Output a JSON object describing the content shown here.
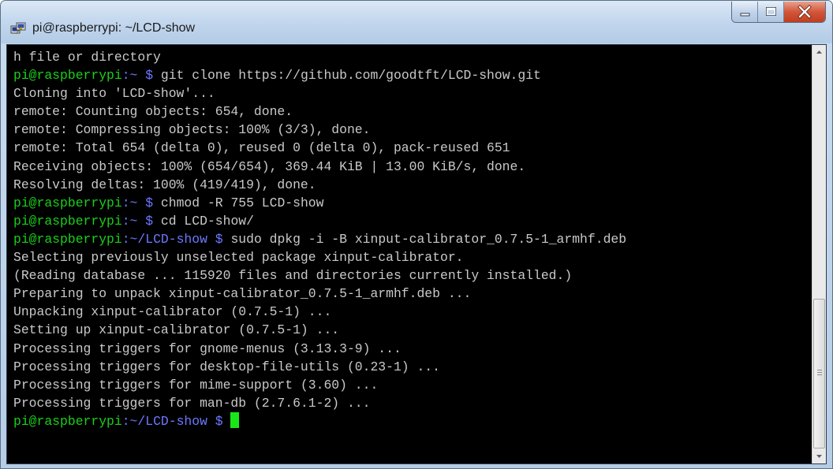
{
  "window": {
    "title": "pi@raspberrypi: ~/LCD-show",
    "icon": "putty-icon",
    "controls": [
      "minimize-icon",
      "maximize-icon",
      "close-icon"
    ]
  },
  "terminal": {
    "lines": [
      {
        "output": "h file or directory"
      },
      {
        "user": "pi@raspberrypi",
        "path": ":~",
        "dollar": " $ ",
        "cmd": "git clone https://github.com/goodtft/LCD-show.git"
      },
      {
        "output": "Cloning into 'LCD-show'..."
      },
      {
        "output": "remote: Counting objects: 654, done."
      },
      {
        "output": "remote: Compressing objects: 100% (3/3), done."
      },
      {
        "output": "remote: Total 654 (delta 0), reused 0 (delta 0), pack-reused 651"
      },
      {
        "output": "Receiving objects: 100% (654/654), 369.44 KiB | 13.00 KiB/s, done."
      },
      {
        "output": "Resolving deltas: 100% (419/419), done."
      },
      {
        "user": "pi@raspberrypi",
        "path": ":~",
        "dollar": " $ ",
        "cmd": "chmod -R 755 LCD-show"
      },
      {
        "user": "pi@raspberrypi",
        "path": ":~",
        "dollar": " $ ",
        "cmd": "cd LCD-show/"
      },
      {
        "user": "pi@raspberrypi",
        "path": ":~/LCD-show",
        "dollar": " $ ",
        "cmd": "sudo dpkg -i -B xinput-calibrator_0.7.5-1_armhf.deb"
      },
      {
        "output": "Selecting previously unselected package xinput-calibrator."
      },
      {
        "output": "(Reading database ... 115920 files and directories currently installed.)"
      },
      {
        "output": "Preparing to unpack xinput-calibrator_0.7.5-1_armhf.deb ..."
      },
      {
        "output": "Unpacking xinput-calibrator (0.7.5-1) ..."
      },
      {
        "output": "Setting up xinput-calibrator (0.7.5-1) ..."
      },
      {
        "output": "Processing triggers for gnome-menus (3.13.3-9) ..."
      },
      {
        "output": "Processing triggers for desktop-file-utils (0.23-1) ..."
      },
      {
        "output": "Processing triggers for mime-support (3.60) ..."
      },
      {
        "output": "Processing triggers for man-db (2.7.6.1-2) ..."
      },
      {
        "user": "pi@raspberrypi",
        "path": ":~/LCD-show",
        "dollar": " $ ",
        "cmd": "",
        "cursor": true
      }
    ]
  },
  "colors": {
    "prompt_user": "#19d019",
    "prompt_path": "#6d78ff",
    "output_text": "#c9c9c9",
    "cursor": "#19e619",
    "background": "#000000"
  }
}
